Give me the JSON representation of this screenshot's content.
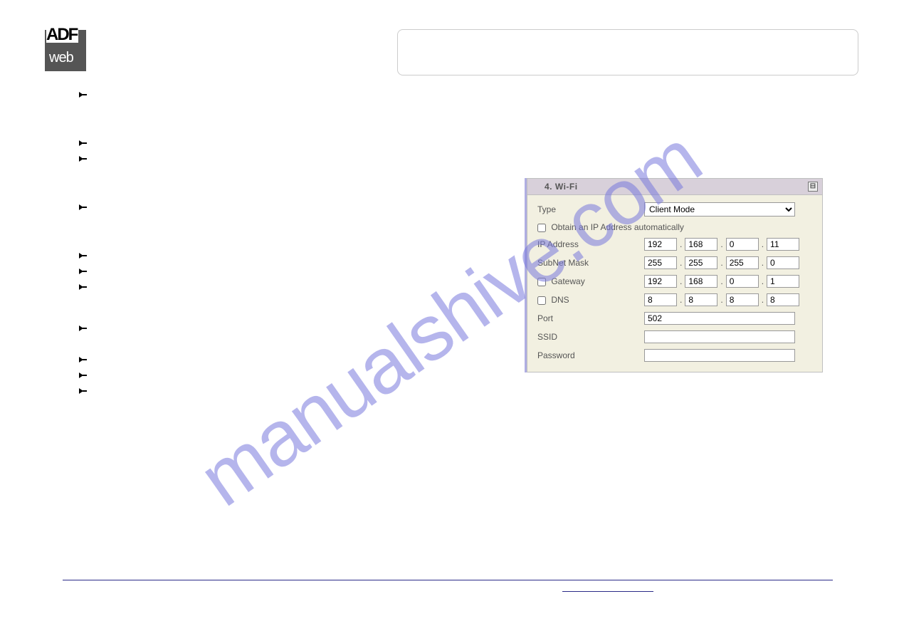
{
  "watermark": "manualshive.com",
  "logo": {
    "top": "ADF",
    "bottom": "web"
  },
  "wifi": {
    "title": "4. Wi-Fi",
    "type_label": "Type",
    "type_value": "Client Mode",
    "obtain_label": "Obtain an IP Address automatically",
    "ip_label": "IP Address",
    "ip": [
      "192",
      "168",
      "0",
      "11"
    ],
    "subnet_label": "SubNet Mask",
    "subnet": [
      "255",
      "255",
      "255",
      "0"
    ],
    "gateway_label": "Gateway",
    "gateway": [
      "192",
      "168",
      "0",
      "1"
    ],
    "dns_label": "DNS",
    "dns": [
      "8",
      "8",
      "8",
      "8"
    ],
    "port_label": "Port",
    "port": "502",
    "ssid_label": "SSID",
    "ssid": "",
    "password_label": "Password",
    "password": "",
    "minimize_glyph": "⊟"
  },
  "bullets": {
    "items": [
      "",
      "",
      "",
      "",
      "",
      "",
      "",
      "",
      "",
      "",
      ""
    ]
  }
}
